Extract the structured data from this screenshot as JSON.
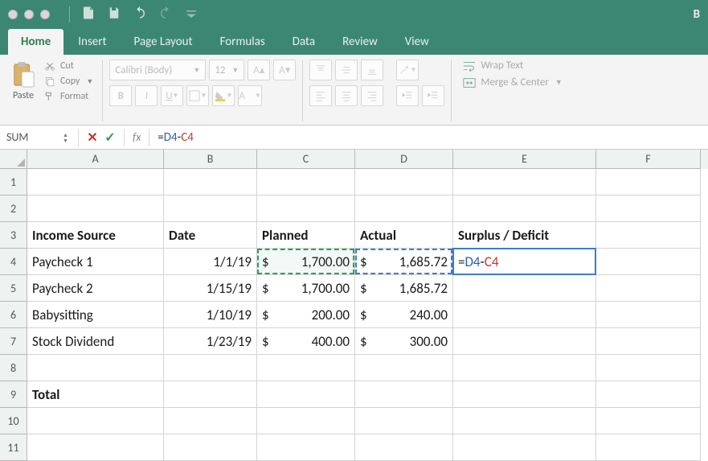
{
  "titlebar": {
    "app_initial": "B"
  },
  "tabs": [
    "Home",
    "Insert",
    "Page Layout",
    "Formulas",
    "Data",
    "Review",
    "View"
  ],
  "active_tab": "Home",
  "ribbon": {
    "paste": "Paste",
    "cut": "Cut",
    "copy": "Copy",
    "format": "Format",
    "font_name": "Calibri (Body)",
    "font_size": "12",
    "wrap": "Wrap Text",
    "merge": "Merge & Center"
  },
  "formula_bar": {
    "name_box": "SUM",
    "fx": "fx",
    "formula_raw": "=D4-C4",
    "formula_parts": {
      "eq": "=",
      "ref1": "D4",
      "op": "-",
      "ref2": "C4"
    }
  },
  "columns": [
    "A",
    "B",
    "C",
    "D",
    "E",
    "F"
  ],
  "row_numbers": [
    "1",
    "2",
    "3",
    "4",
    "5",
    "6",
    "7",
    "8",
    "9",
    "10",
    "11"
  ],
  "sheet": {
    "headers": {
      "A3": "Income Source",
      "B3": "Date",
      "C3": "Planned",
      "D3": "Actual",
      "E3": "Surplus / Deficit"
    },
    "rows": [
      {
        "A": "Paycheck 1",
        "B": "1/1/19",
        "C": "1,700.00",
        "D": "1,685.72"
      },
      {
        "A": "Paycheck 2",
        "B": "1/15/19",
        "C": "1,700.00",
        "D": "1,685.72"
      },
      {
        "A": "Babysitting",
        "B": "1/10/19",
        "C": "200.00",
        "D": "240.00"
      },
      {
        "A": "Stock Dividend",
        "B": "1/23/19",
        "C": "400.00",
        "D": "300.00"
      }
    ],
    "currency_symbol": "$",
    "total_label": "Total"
  },
  "editing_cell": {
    "address": "E4",
    "display_parts": {
      "eq": "=",
      "ref1": "D4",
      "op": "-",
      "ref2": "C4"
    }
  }
}
